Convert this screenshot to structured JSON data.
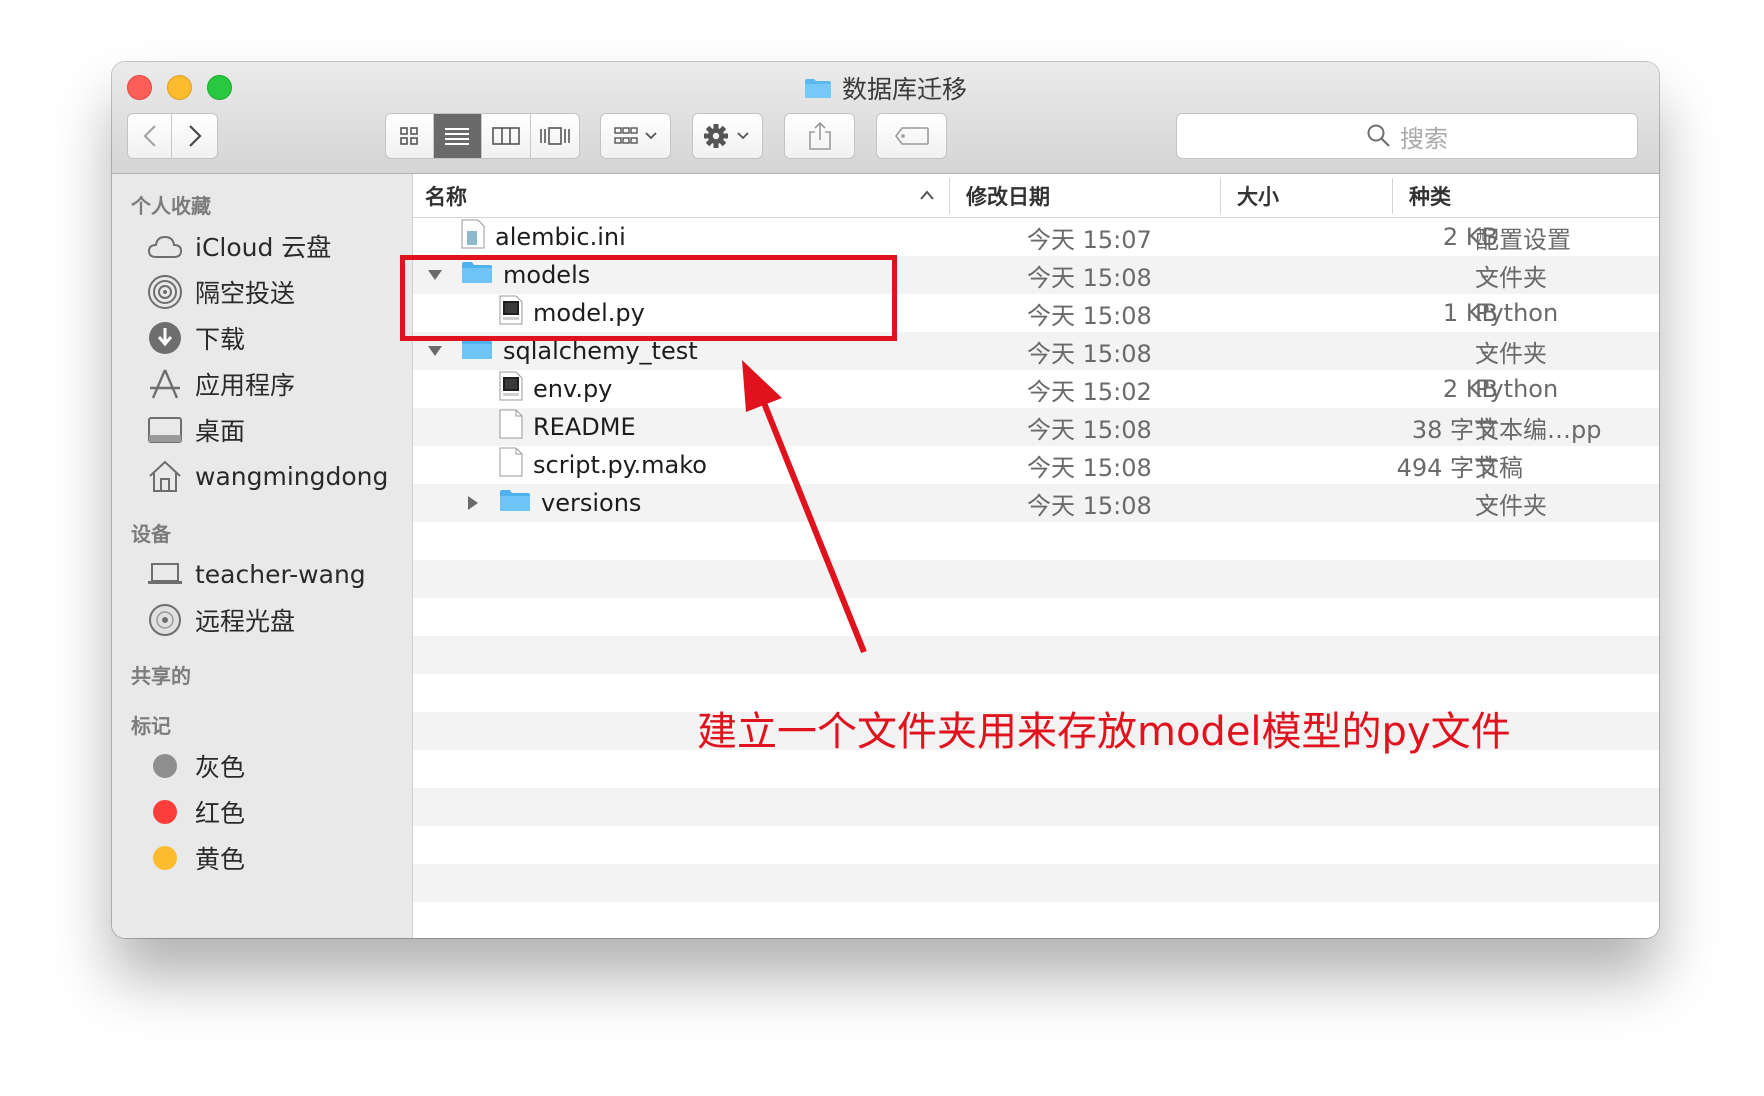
{
  "window": {
    "title": "数据库迁移",
    "title_icon": "folder-icon"
  },
  "toolbar": {
    "back_icon": "chevron-left-icon",
    "forward_icon": "chevron-right-icon",
    "view_modes": [
      "icon-view",
      "list-view",
      "column-view",
      "cover-flow-view"
    ],
    "active_view": "list-view",
    "arrange_icon": "arrange-grid-icon",
    "action_icon": "gear-icon",
    "share_icon": "share-icon",
    "tag_icon": "tag-icon",
    "search_placeholder": "搜索"
  },
  "sidebar": {
    "favorites_title": "个人收藏",
    "favorites": [
      {
        "label": "iCloud 云盘",
        "icon": "cloud-icon"
      },
      {
        "label": "隔空投送",
        "icon": "airdrop-icon"
      },
      {
        "label": "下载",
        "icon": "download-icon"
      },
      {
        "label": "应用程序",
        "icon": "applications-icon"
      },
      {
        "label": "桌面",
        "icon": "desktop-icon"
      },
      {
        "label": "wangmingdong",
        "icon": "home-icon"
      }
    ],
    "devices_title": "设备",
    "devices": [
      {
        "label": "teacher-wang",
        "icon": "laptop-icon"
      },
      {
        "label": "远程光盘",
        "icon": "disc-icon"
      }
    ],
    "shared_title": "共享的",
    "tags_title": "标记",
    "tags": [
      {
        "label": "灰色",
        "color": "#8e8e8e"
      },
      {
        "label": "红色",
        "color": "#fc3d39"
      },
      {
        "label": "黄色",
        "color": "#fdbc2e"
      }
    ]
  },
  "columns": {
    "name": "名称",
    "date": "修改日期",
    "size": "大小",
    "kind": "种类",
    "sort_icon": "chevron-up-icon"
  },
  "files": [
    {
      "name": "alembic.ini",
      "date": "今天 15:07",
      "size": "2 KB",
      "kind": "配置设置",
      "type": "file-ini",
      "indent": 1,
      "disclosure": ""
    },
    {
      "name": "models",
      "date": "今天 15:08",
      "size": "--",
      "kind": "文件夹",
      "type": "folder",
      "indent": 1,
      "disclosure": "expanded"
    },
    {
      "name": "model.py",
      "date": "今天 15:08",
      "size": "1 KB",
      "kind": "Python",
      "type": "file-py",
      "indent": 2,
      "disclosure": ""
    },
    {
      "name": "sqlalchemy_test",
      "date": "今天 15:08",
      "size": "--",
      "kind": "文件夹",
      "type": "folder",
      "indent": 1,
      "disclosure": "expanded"
    },
    {
      "name": "env.py",
      "date": "今天 15:02",
      "size": "2 KB",
      "kind": "Python",
      "type": "file-py",
      "indent": 2,
      "disclosure": ""
    },
    {
      "name": "README",
      "date": "今天 15:08",
      "size": "38 字节",
      "kind": "文本编…pp",
      "type": "file-blank",
      "indent": 2,
      "disclosure": ""
    },
    {
      "name": "script.py.mako",
      "date": "今天 15:08",
      "size": "494 字节",
      "kind": "文稿",
      "type": "file-blank",
      "indent": 2,
      "disclosure": ""
    },
    {
      "name": "versions",
      "date": "今天 15:08",
      "size": "--",
      "kind": "文件夹",
      "type": "folder",
      "indent": 2,
      "disclosure": "collapsed"
    }
  ],
  "annotation": {
    "text": "建立一个文件夹用来存放model模型的py文件",
    "color": "#e0121d"
  }
}
